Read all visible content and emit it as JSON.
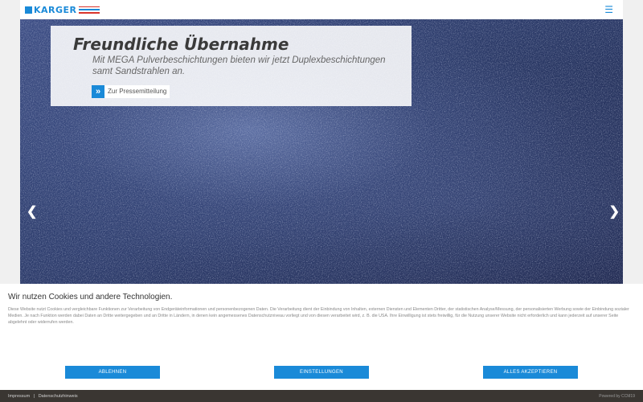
{
  "header": {
    "logo_text": "KARGER",
    "colors": {
      "brand_blue": "#1a8ad8",
      "brand_red": "#d9342b"
    },
    "menu_icon": "hamburger-menu-icon"
  },
  "hero": {
    "title": "Freundliche Übernahme",
    "text": "Mit MEGA Pulverbeschichtungen bieten wir jetzt Duplexbeschichtungen samt Sandstrahlen an.",
    "press_link_label": "Zur Pressemitteilung",
    "prev_icon": "chevron-left-icon",
    "next_icon": "chevron-right-icon"
  },
  "cookie": {
    "title": "Wir nutzen Cookies und andere Technologien.",
    "text": "Diese Website nutzt Cookies und vergleichbare Funktionen zur Verarbeitung von Endgeräteinformationen und personenbezogenen Daten. Die Verarbeitung dient der Einbindung von Inhalten, externen Diensten und Elementen Dritter, der statistischen Analyse/Messung, der personalisierten Werbung sowie der Einbindung sozialer Medien. Je nach Funktion werden dabei Daten an Dritte weitergegeben und an Dritte in Ländern, in denen kein angemessenes Datenschutzniveau vorliegt und von diesen verarbeitet wird, z. B. die USA. Ihre Einwilligung ist stets freiwillig, für die Nutzung unserer Website nicht erforderlich und kann jederzeit auf unserer Seite abgelehnt oder widerrufen werden.",
    "decline_label": "ABLEHNEN",
    "settings_label": "EINSTELLUNGEN",
    "accept_label": "ALLES AKZEPTIEREN"
  },
  "footer": {
    "impressum": "Impressum",
    "separator": "|",
    "datenschutz": "Datenschutzhinweis",
    "powered_by": "Powered by CCM19"
  }
}
